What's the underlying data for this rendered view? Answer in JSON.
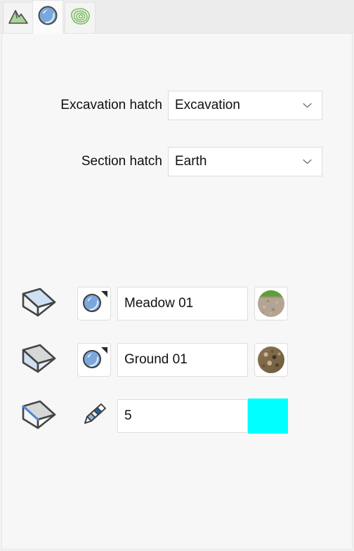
{
  "tabs": [
    {
      "name": "terrain-tab",
      "icon": "mountain-icon",
      "active": false
    },
    {
      "name": "material-tab",
      "icon": "sphere-icon",
      "active": true
    },
    {
      "name": "contour-tab",
      "icon": "contour-icon",
      "active": false
    }
  ],
  "hatch_settings": [
    {
      "label": "Excavation hatch",
      "value": "Excavation",
      "arrow_icon": "chevron-down-icon"
    },
    {
      "label": "Section hatch",
      "value": "Earth",
      "arrow_icon": "chevron-down-icon"
    }
  ],
  "material_rows": [
    {
      "surface_icon": "wedge-top-face-icon",
      "surface_part": "top",
      "action_icon": "sphere-material-icon",
      "action_type": "material",
      "value": "Meadow 01",
      "swatch_type": "texture",
      "swatch_name": "meadow-texture-swatch",
      "texture_colors": {
        "top": "#5f9c3f",
        "base": "#b4a493",
        "speckle": "#8b7d6b"
      }
    },
    {
      "surface_icon": "wedge-side-face-icon",
      "surface_part": "side",
      "action_icon": "sphere-material-icon",
      "action_type": "material",
      "value": "Ground 01",
      "swatch_type": "texture",
      "swatch_name": "ground-texture-swatch",
      "texture_colors": {
        "top": "#7d6a4e",
        "base": "#8a7454",
        "speckle": "#4b3c28"
      }
    },
    {
      "surface_icon": "wedge-edge-icon",
      "surface_part": "edge",
      "action_icon": "pencil-icon",
      "action_type": "line",
      "value": "5",
      "swatch_type": "color",
      "swatch_name": "line-color-swatch",
      "color": "#00FFFF"
    }
  ],
  "colors": {
    "accent_blue": "#4b87d4",
    "highlight_face": "#cfe0f2",
    "cyan": "#00FFFF",
    "panel_bg": "#f7f7f7",
    "tab_bg": "#ececec",
    "active_tab_bg": "#fbfbfb",
    "outline": "#454545",
    "green": "#8cc474"
  }
}
